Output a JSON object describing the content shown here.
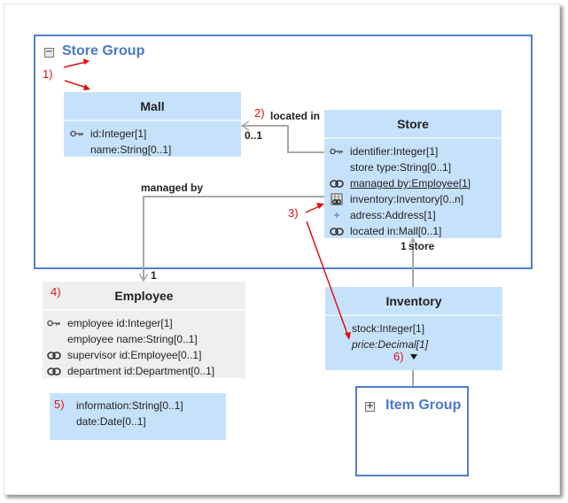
{
  "groups": {
    "store_group": {
      "title": "Store Group",
      "toggle": "−",
      "state": "expanded"
    },
    "item_group": {
      "title": "Item Group",
      "toggle": "+",
      "state": "collapsed"
    }
  },
  "classes": {
    "mall": {
      "name": "Mall",
      "attributes": [
        {
          "icon": "key-icon",
          "text": "id:Integer[1]"
        },
        {
          "icon": "none",
          "text": "name:String[0..1]"
        }
      ]
    },
    "store": {
      "name": "Store",
      "attributes": [
        {
          "icon": "key-icon",
          "text": "identifier:Integer[1]"
        },
        {
          "icon": "none",
          "text": "store type:String[0..1]"
        },
        {
          "icon": "link-icon",
          "text": "managed by:Employee[1]",
          "underlined": true
        },
        {
          "icon": "table-link-icon",
          "text": "inventory:Inventory[0..n]"
        },
        {
          "icon": "plus-icon",
          "text": "adress:Address[1]"
        },
        {
          "icon": "link-icon",
          "text": "located in:Mall[0..1]"
        }
      ]
    },
    "employee": {
      "name": "Employee",
      "attributes": [
        {
          "icon": "key-icon",
          "text": "employee id:Integer[1]"
        },
        {
          "icon": "none",
          "text": "employee name:String[0..1]"
        },
        {
          "icon": "link-icon",
          "text": "supervisor id:Employee[0..1]"
        },
        {
          "icon": "link-icon",
          "text": "department id:Department[0..1]"
        }
      ]
    },
    "unnamed": {
      "attributes": [
        {
          "text": "information:String[0..1]"
        },
        {
          "text": "date:Date[0..1]"
        }
      ]
    },
    "inventory": {
      "name": "Inventory",
      "attributes": [
        {
          "text": "stock:Integer[1]"
        },
        {
          "text": "price:Decimal[1]",
          "italic": true
        }
      ],
      "expander": "more-attributes-icon"
    }
  },
  "relationships": {
    "located_in": {
      "label": "located in",
      "multiplicity": "0..1"
    },
    "managed_by": {
      "label": "managed by",
      "multiplicity": "1"
    },
    "store_inventory": {
      "label": "store",
      "multiplicity": "1"
    }
  },
  "annotations": [
    "1)",
    "2)",
    "3)",
    "4)",
    "5)",
    "6)"
  ],
  "colors": {
    "group_border": "#4f7fcf",
    "group_title": "#4a78c8",
    "class_fill": "#c6e2fb",
    "class_fill_grey": "#efefef",
    "connector": "#a8a8a8",
    "annotation": "#e01010"
  }
}
